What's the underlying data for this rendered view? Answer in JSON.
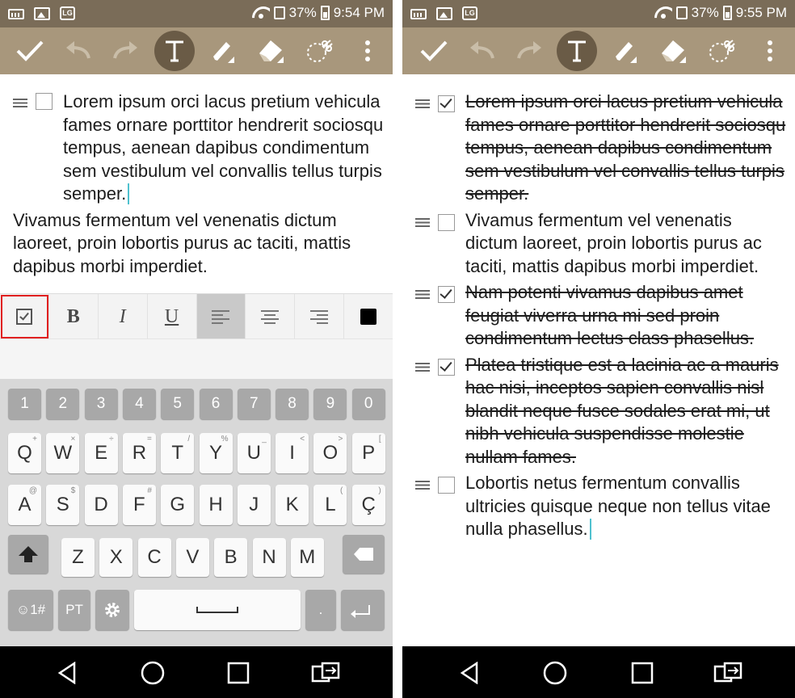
{
  "left": {
    "status": {
      "battery": "37%",
      "time": "9:54 PM"
    },
    "note": {
      "items": [
        {
          "checked": false,
          "text": "Lorem ipsum orci lacus pretium vehicula fames ornare porttitor hendrerit sociosqu tempus, aenean dapibus condimentum sem vestibulum vel convallis tellus turpis semper."
        }
      ],
      "paragraph": "Vivamus fermentum vel venenatis dictum laoreet, proin lobortis purus ac taciti, mattis dapibus morbi imperdiet."
    },
    "format_bar": {
      "bold": "B",
      "italic": "I",
      "underline": "U"
    },
    "keyboard": {
      "numbers": [
        "1",
        "2",
        "3",
        "4",
        "5",
        "6",
        "7",
        "8",
        "9",
        "0"
      ],
      "row1": [
        "Q",
        "W",
        "E",
        "R",
        "T",
        "Y",
        "U",
        "I",
        "O",
        "P"
      ],
      "row1_hints": [
        "+",
        "×",
        "÷",
        "=",
        "/",
        "%",
        "_",
        "<",
        ">",
        "["
      ],
      "row2": [
        "A",
        "S",
        "D",
        "F",
        "G",
        "H",
        "J",
        "K",
        "L",
        "Ç"
      ],
      "row2_hints": [
        "@",
        "$",
        "",
        "#",
        "",
        "",
        "",
        "",
        "(",
        ")"
      ],
      "row3": [
        "Z",
        "X",
        "C",
        "V",
        "B",
        "N",
        "M"
      ],
      "symbols_key": "☺1#",
      "language_key": "PT",
      "period_key": "."
    }
  },
  "right": {
    "status": {
      "battery": "37%",
      "time": "9:55 PM"
    },
    "note": {
      "items": [
        {
          "checked": true,
          "text": "Lorem ipsum orci lacus pretium vehicula fames ornare porttitor hendrerit sociosqu tempus, aenean dapibus condimentum sem vestibulum vel convallis tellus turpis semper."
        },
        {
          "checked": false,
          "text": "Vivamus fermentum vel venenatis dictum laoreet, proin lobortis purus ac taciti, mattis dapibus morbi imperdiet."
        },
        {
          "checked": true,
          "text": "Nam potenti vivamus dapibus amet feugiat viverra urna mi sed proin condimentum lectus class phasellus."
        },
        {
          "checked": true,
          "text": "Platea tristique est a lacinia ac a mauris hac nisi, inceptos sapien convallis nisl blandit neque fusce sodales erat mi, ut nibh vehicula suspendisse molestie nullam fames."
        },
        {
          "checked": false,
          "text": "Lobortis netus fermentum convallis ultricies quisque neque non tellus vitae nulla phasellus."
        }
      ]
    }
  },
  "colors": {
    "status_bar": "#7a6c58",
    "toolbar": "#a8977c",
    "active_tool": "#6a5b46",
    "caret": "#4fc1cf",
    "highlight": "#e02020"
  },
  "icons": {
    "toolbar": [
      "check-icon",
      "undo-icon",
      "redo-icon",
      "text-tool-icon",
      "pen-icon",
      "eraser-icon",
      "lasso-scissors-icon",
      "more-vert-icon"
    ],
    "nav": [
      "back-icon",
      "home-icon",
      "recents-icon",
      "qslide-icon"
    ]
  }
}
